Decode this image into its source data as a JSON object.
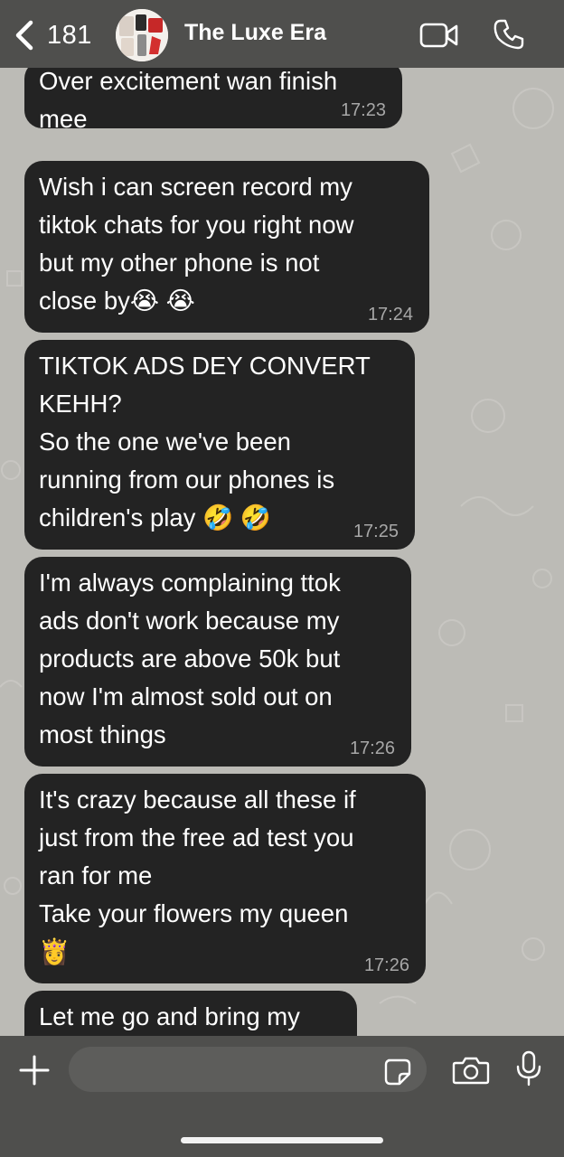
{
  "header": {
    "back_count": "181",
    "title": "The Luxe Era"
  },
  "messages": [
    {
      "text": "Over excitement wan finish\nmee",
      "time": "17:23"
    },
    {
      "text": "Wish i can screen record my\ntiktok chats for you right now\nbut my other phone is not\nclose by😭 😭",
      "time": "17:24"
    },
    {
      "text": "TIKTOK ADS DEY CONVERT\nKEHH?\nSo the one we've been\nrunning from our phones is\nchildren's play 🤣 🤣",
      "time": "17:25"
    },
    {
      "text": "I'm always complaining ttok\nads don't work because my\nproducts are above 50k but\nnow I'm almost sold out on\nmost things",
      "time": "17:26"
    },
    {
      "text": "It's crazy because all these if\njust from the free ad test you\nran for me\nTake your flowers my queen\n👸",
      "time": "17:26"
    },
    {
      "text": "Let me go and bring my",
      "time": ""
    }
  ],
  "input": {
    "value": ""
  },
  "icons": {
    "back": "chevron-left-icon",
    "video": "video-call-icon",
    "voice": "phone-call-icon",
    "attach": "plus-icon",
    "sticker": "sticker-icon",
    "camera": "camera-icon",
    "mic": "microphone-icon"
  },
  "colors": {
    "header_bg": "#4f4f4d",
    "bubble_bg": "#232323",
    "wallpaper": "#bcbbb6",
    "timestamp": "#a7a7a7"
  }
}
